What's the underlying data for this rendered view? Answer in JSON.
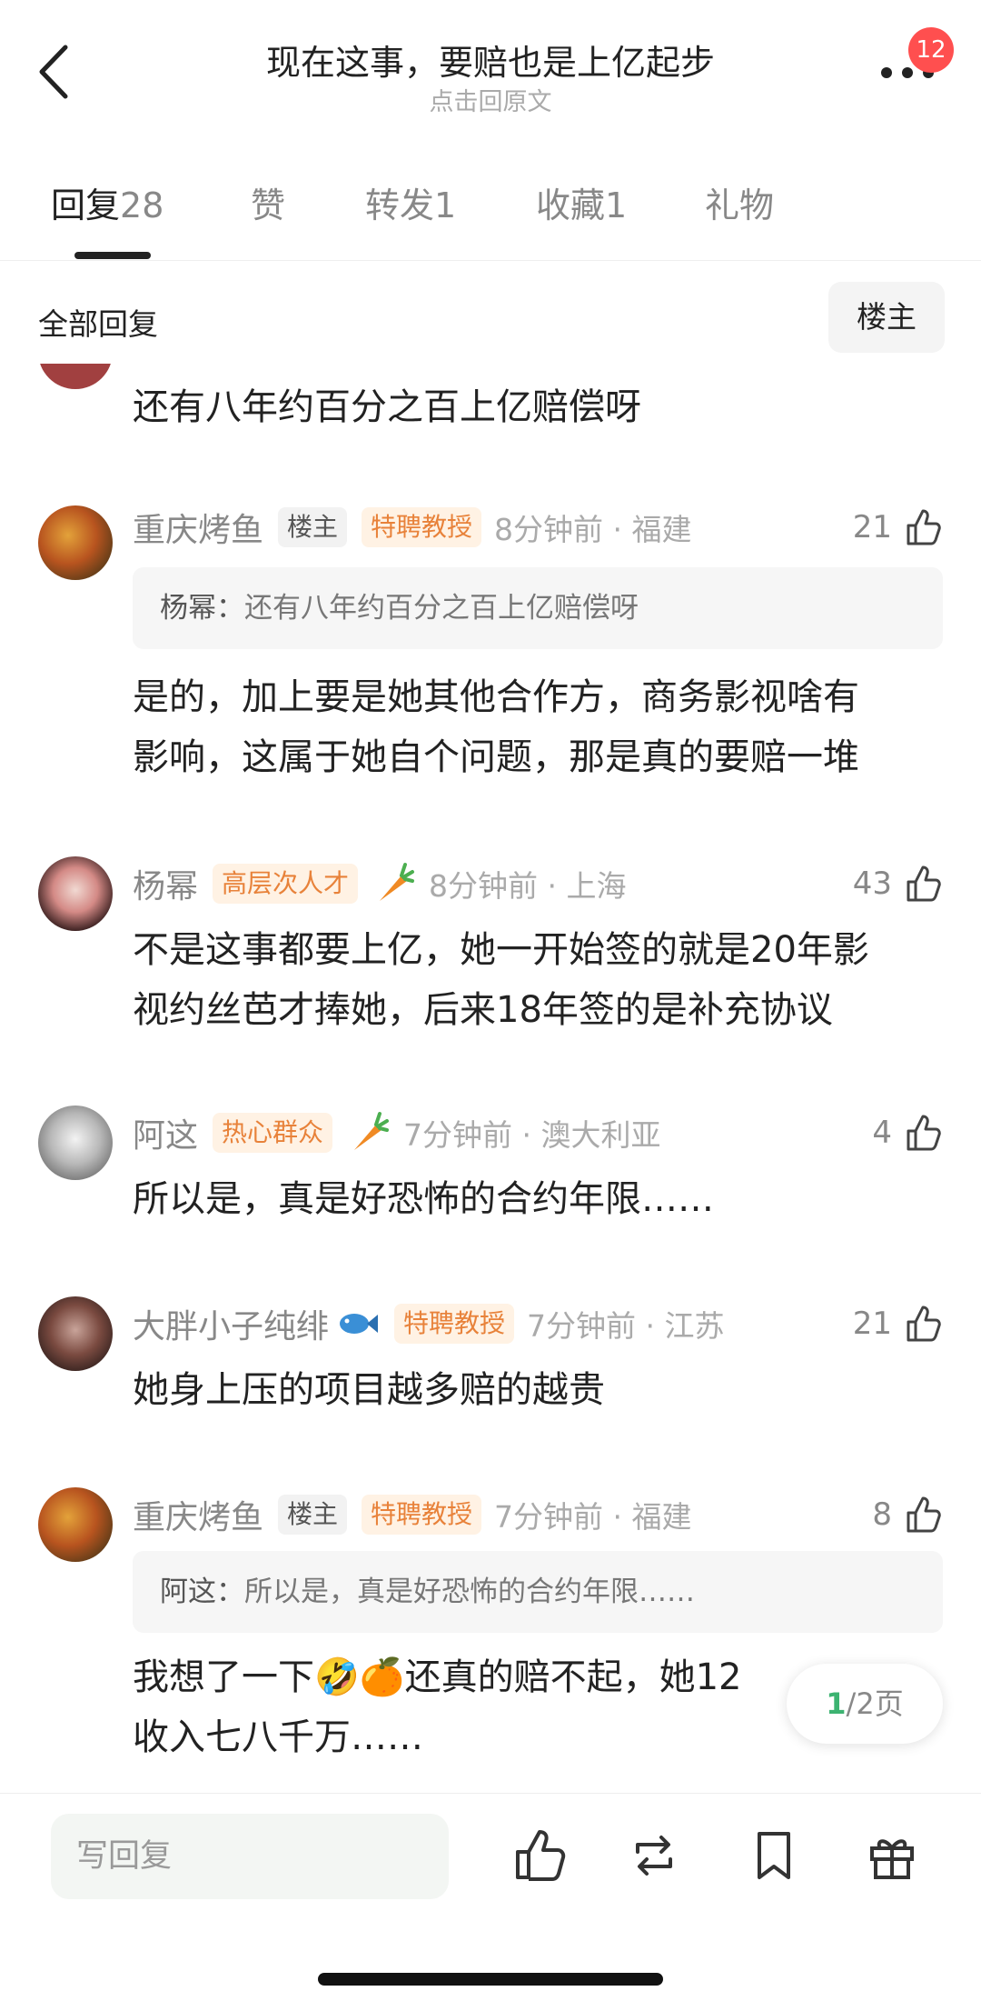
{
  "header": {
    "title": "现在这事，要赔也是上亿起步",
    "subtitle": "点击回原文",
    "badge": "12"
  },
  "tabs": [
    {
      "label": "回复",
      "count": "28"
    },
    {
      "label": "赞",
      "count": ""
    },
    {
      "label": "转发",
      "count": "1"
    },
    {
      "label": "收藏",
      "count": "1"
    },
    {
      "label": "礼物",
      "count": ""
    }
  ],
  "section": {
    "title": "全部回复",
    "owner_button": "楼主"
  },
  "partial_comment": {
    "text": "还有八年约百分之百上亿赔偿呀"
  },
  "comments": [
    {
      "user": "重庆烤鱼",
      "tags": [
        "楼主",
        "特聘教授"
      ],
      "time": "8分钟前 · 福建",
      "likes": "21",
      "quote_name": "杨幂：",
      "quote_text": "还有八年约百分之百上亿赔偿呀",
      "text_lines": [
        "是的，加上要是她其他合作方，商务影视啥有",
        "影响，这属于她自个问题，那是真的要赔一堆"
      ]
    },
    {
      "user": "杨幂",
      "tags": [
        "高层次人才"
      ],
      "time": "8分钟前 · 上海",
      "likes": "43",
      "icon": "carrot-icon",
      "text_lines": [
        "不是这事都要上亿，她一开始签的就是20年影",
        "视约丝芭才捧她，后来18年签的是补充协议"
      ]
    },
    {
      "user": "阿这",
      "tags": [
        "热心群众"
      ],
      "time": "7分钟前 · 澳大利亚",
      "likes": "4",
      "icon": "carrot-icon",
      "text_lines": [
        "所以是，真是好恐怖的合约年限……"
      ]
    },
    {
      "user": "大胖小子纯绯",
      "user_icon": "fish-icon",
      "tags": [
        "特聘教授"
      ],
      "time": "7分钟前 · 江苏",
      "likes": "21",
      "text_lines": [
        "她身上压的项目越多赔的越贵"
      ]
    },
    {
      "user": "重庆烤鱼",
      "tags": [
        "楼主",
        "特聘教授"
      ],
      "time": "7分钟前 · 福建",
      "likes": "8",
      "quote_name": "阿这：",
      "quote_text": "所以是，真是好恐怖的合约年限……",
      "text_lines": [
        "我想了一下🤣🍊还真的赔不起，她12",
        "收入七八千万……"
      ]
    }
  ],
  "pager": {
    "current": "1",
    "total": "/2页"
  },
  "bottom_bar": {
    "input_placeholder": "写回复",
    "icons": [
      "thumbs-up-icon",
      "repost-icon",
      "bookmark-icon",
      "gift-icon"
    ]
  },
  "colors": {
    "tag_orange": "#e8823a",
    "badge_red": "#ff4f4f",
    "pager_green": "#3cb371"
  }
}
